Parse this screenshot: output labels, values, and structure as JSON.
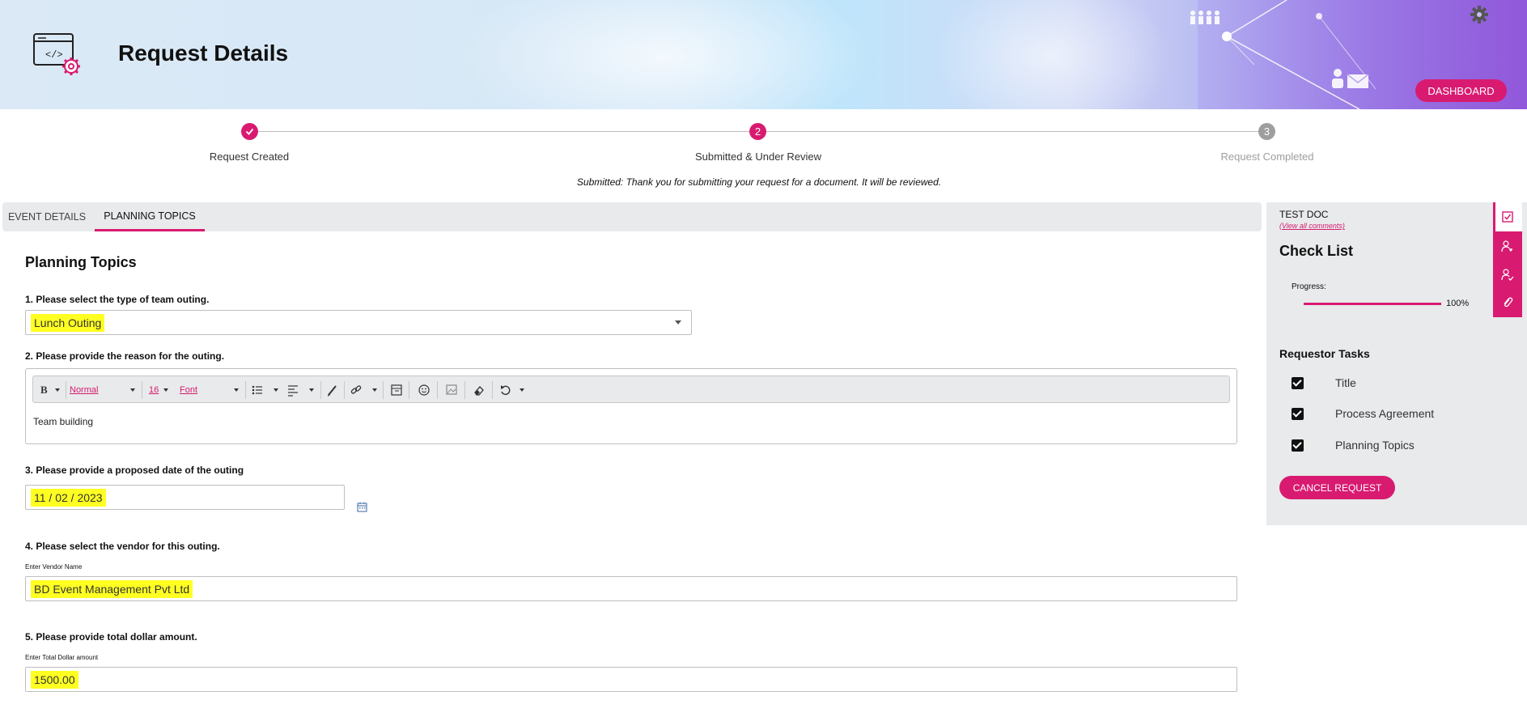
{
  "header": {
    "title": "Request Details",
    "dashboard_label": "DASHBOARD",
    "accent": "#d81b71"
  },
  "stepper": {
    "steps": [
      {
        "label": "Request Created",
        "state": "done",
        "number": ""
      },
      {
        "label": "Submitted & Under Review",
        "state": "active",
        "number": "2"
      },
      {
        "label": "Request Completed",
        "state": "pending",
        "number": "3"
      }
    ],
    "message": "Submitted: Thank you for submitting your request for a document. It will be reviewed."
  },
  "tabs": [
    {
      "label": "EVENT DETAILS",
      "active": false
    },
    {
      "label": "PLANNING TOPICS",
      "active": true
    }
  ],
  "form": {
    "section_title": "Planning Topics",
    "q1": {
      "label": "1. Please select the type of team outing.",
      "value": "Lunch Outing"
    },
    "q2": {
      "label": "2. Please provide the reason for the outing.",
      "toolbar": {
        "bold": "B",
        "style": "Normal",
        "size": "16",
        "font": "Font"
      },
      "value": "Team building"
    },
    "q3": {
      "label": "3. Please provide a proposed date of the outing",
      "value": "11 / 02 / 2023"
    },
    "q4": {
      "label": "4. Please select the vendor for this outing.",
      "sublabel": "Enter Vendor Name",
      "value": "BD Event Management Pvt Ltd"
    },
    "q5": {
      "label": "5. Please provide total dollar amount.",
      "sublabel": "Enter Total Dollar amount",
      "value": "1500.00"
    }
  },
  "panel": {
    "doc_title": "TEST DOC",
    "view_comments": "(View all comments)",
    "checklist_title": "Check List",
    "progress_label": "Progress:",
    "progress_value": "100%",
    "progress_fraction": 1.0,
    "tasks_title": "Requestor Tasks",
    "tasks": [
      {
        "label": "Title",
        "checked": true
      },
      {
        "label": "Process Agreement",
        "checked": true
      },
      {
        "label": "Planning Topics",
        "checked": true
      }
    ],
    "cancel_label": "CANCEL REQUEST"
  },
  "icons": {
    "app": "code-window-gear-icon",
    "settings": "gear-icon",
    "calendar": "calendar-icon",
    "strip": [
      "checklist-icon",
      "user-heart-icon",
      "user-check-icon",
      "paperclip-icon"
    ]
  }
}
